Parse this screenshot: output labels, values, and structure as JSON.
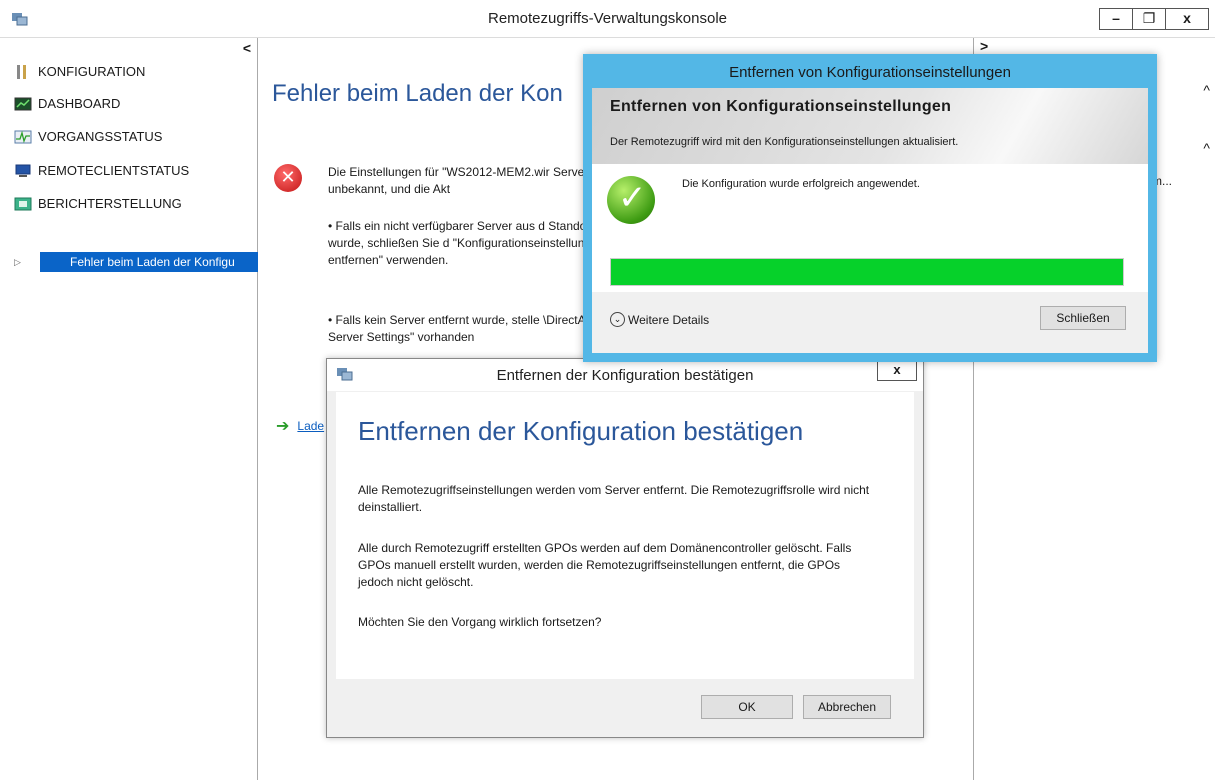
{
  "window": {
    "title": "Remotezugriffs-Verwaltungskonsole",
    "minimize": "–",
    "restore": "❐",
    "close": "x"
  },
  "leftnav": {
    "collapse": "<",
    "items": [
      {
        "label": "KONFIGURATION",
        "icon": "tools-icon"
      },
      {
        "label": "DASHBOARD",
        "icon": "dashboard-icon"
      },
      {
        "label": "VORGANGSSTATUS",
        "icon": "network-status-icon"
      },
      {
        "label": "REMOTECLIENTSTATUS",
        "icon": "computer-icon"
      },
      {
        "label": "BERICHTERSTELLUNG",
        "icon": "report-icon"
      }
    ],
    "tree": {
      "label": "Fehler beim Laden der Konfigu",
      "arrow": "▷"
    }
  },
  "center": {
    "heading": "Fehler beim Laden der Kon",
    "para1": "Die Einstellungen für \"WS2012-MEM2.wir Serverzustand ist unbekannt, und die Akt",
    "para2": "•  Falls ein nicht verfügbarer Server aus d Standorte entfernt wurde, schließen Sie d \"Konfigurationseinstellungen entfernen\" verwenden.",
    "para3": "•  Falls kein Server entfernt wurde, stelle \\DirectAccess Server Settings\" vorhanden",
    "link": "Lade"
  },
  "rightpanel": {
    "arrow": ">",
    "caret1": "^",
    "caret2": "^",
    "text": "tum..."
  },
  "confirm_dialog": {
    "title": "Entfernen der Konfiguration bestätigen",
    "close": "x",
    "heading": "Entfernen der Konfiguration bestätigen",
    "para1": "Alle Remotezugriffseinstellungen werden vom Server entfernt. Die Remotezugriffsrolle wird nicht deinstalliert.",
    "para2": "Alle durch Remotezugriff erstellten GPOs werden auf dem Domänencontroller gelöscht. Falls GPOs manuell erstellt wurden, werden die Remotezugriffseinstellungen entfernt, die GPOs jedoch nicht gelöscht.",
    "question": "Möchten Sie den Vorgang wirklich fortsetzen?",
    "ok": "OK",
    "cancel": "Abbrechen"
  },
  "progress_dialog": {
    "title": "Entfernen von Konfigurationseinstellungen",
    "header": "Entfernen von Konfigurationseinstellungen",
    "subheader": "Der Remotezugriff wird mit den Konfigurationseinstellungen aktualisiert.",
    "message": "Die Konfiguration wurde erfolgreich angewendet.",
    "progress_percent": 100,
    "details": "Weitere Details",
    "close_button": "Schließen"
  }
}
